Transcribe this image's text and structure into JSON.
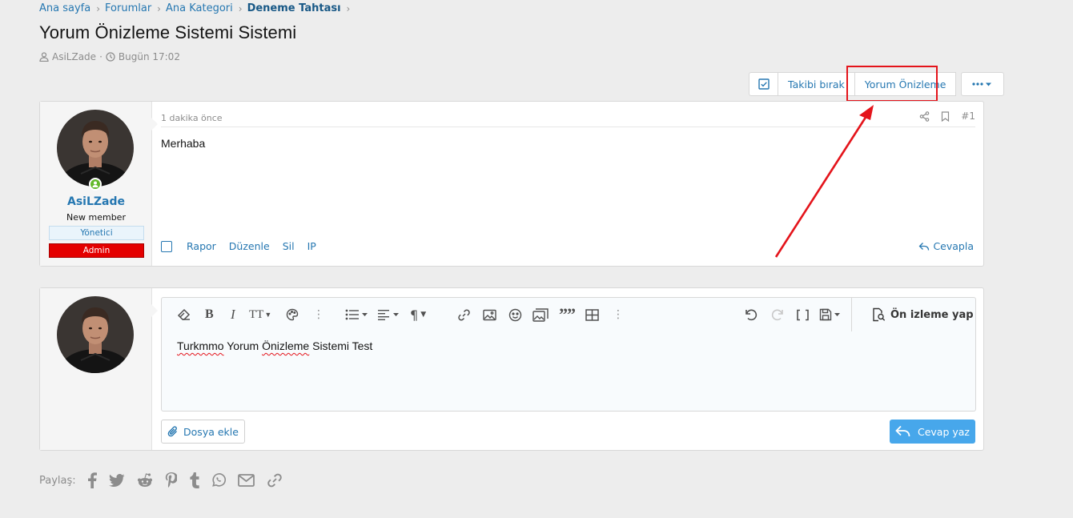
{
  "breadcrumb": [
    "Ana sayfa",
    "Forumlar",
    "Ana Kategori",
    "Deneme Tahtası"
  ],
  "thread": {
    "title": "Yorum Önizleme Sistemi Sistemi",
    "author": "AsiLZade",
    "date": "Bugün 17:02"
  },
  "actions": {
    "unfollow": "Takibi bırak",
    "preview": "Yorum Önizleme"
  },
  "post": {
    "username": "AsiLZade",
    "user_title": "New member",
    "banners": [
      "Yönetici",
      "Admin"
    ],
    "time": "1 dakika önce",
    "number": "#1",
    "body": "Merhaba",
    "footer_actions": [
      "Rapor",
      "Düzenle",
      "Sil",
      "IP"
    ],
    "reply_label": "Cevapla"
  },
  "editor": {
    "preview_label": "Ön izleme yap",
    "text_word1": "Turkmmo",
    "text_word2": " Yorum ",
    "text_word3": "Önizleme",
    "text_word4": " Sistemi Test",
    "attach_label": "Dosya ekle",
    "submit_label": "Cevap yaz"
  },
  "share": {
    "label": "Paylaş:",
    "icons": [
      "facebook-icon",
      "twitter-icon",
      "reddit-icon",
      "pinterest-icon",
      "tumblr-icon",
      "whatsapp-icon",
      "email-icon",
      "link-icon"
    ]
  },
  "colors": {
    "link": "#2577b1",
    "annotation": "#e4141b",
    "submit": "#47a7eb",
    "admin_banner": "#e40000",
    "online": "#63b92b"
  }
}
